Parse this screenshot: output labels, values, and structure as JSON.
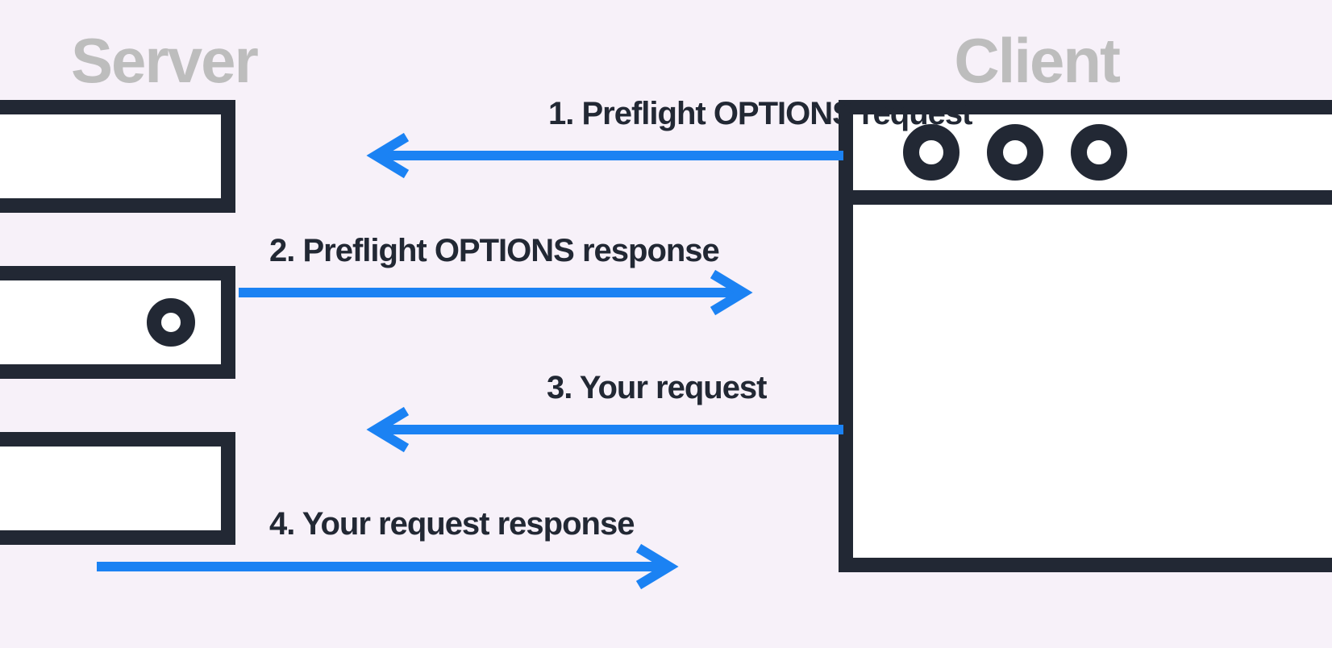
{
  "server_label": "Server",
  "client_label": "Client",
  "arrows": {
    "a1": "1. Preflight OPTIONS request",
    "a2": "2. Preflight OPTIONS response",
    "a3": "3. Your request",
    "a4": "4. Your request response"
  },
  "colors": {
    "arrow": "#1b82f3",
    "ink": "#222834"
  }
}
